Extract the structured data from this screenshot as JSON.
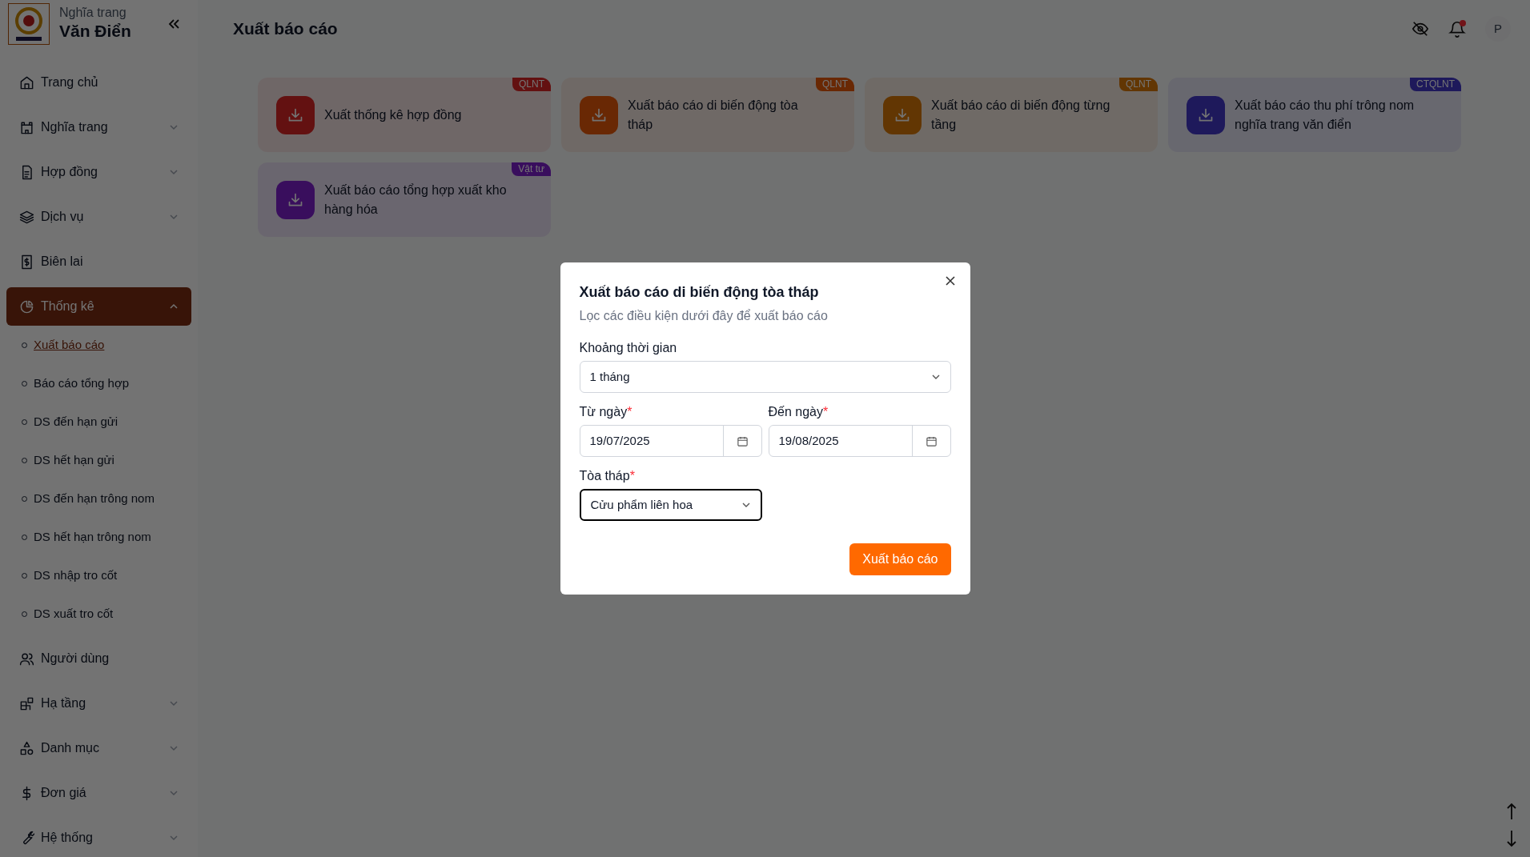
{
  "brand": {
    "subtitle": "Nghĩa trang",
    "title": "Văn Điển"
  },
  "sidebar": {
    "items": [
      {
        "label": "Trang chủ",
        "selected": false
      },
      {
        "label": "Nghĩa trang",
        "selected": false,
        "expanded": false
      },
      {
        "label": "Hợp đồng",
        "selected": false,
        "expanded": false
      },
      {
        "label": "Dịch vụ",
        "selected": false,
        "expanded": false
      },
      {
        "label": "Biên lai",
        "selected": false
      },
      {
        "label": "Thống kê",
        "selected": true,
        "expanded": true,
        "children": [
          {
            "label": "Xuất báo cáo",
            "selected": true
          },
          {
            "label": "Báo cáo tổng hợp",
            "selected": false
          },
          {
            "label": "DS đến hạn gửi",
            "selected": false
          },
          {
            "label": "DS hết hạn gửi",
            "selected": false
          },
          {
            "label": "DS đến hạn trông nom",
            "selected": false
          },
          {
            "label": "DS hết hạn trông nom",
            "selected": false
          },
          {
            "label": "DS nhập tro cốt",
            "selected": false
          },
          {
            "label": "DS xuất tro cốt",
            "selected": false
          }
        ]
      },
      {
        "label": "Người dùng",
        "selected": false
      },
      {
        "label": "Hạ tầng",
        "selected": false,
        "expanded": false
      },
      {
        "label": "Danh mục",
        "selected": false,
        "expanded": false
      },
      {
        "label": "Đơn giá",
        "selected": false,
        "expanded": false
      },
      {
        "label": "Hệ thống",
        "selected": false,
        "expanded": false
      }
    ]
  },
  "page_title": "Xuất báo cáo",
  "header": {
    "avatar": "P",
    "notification": true
  },
  "report_cards": [
    {
      "title": "Xuất thống kê hợp đồng",
      "badge": "QLNT",
      "color": "#631111"
    },
    {
      "title": "Xuất báo cáo di biến động tòa tháp",
      "badge": "QLNT",
      "color": "#692805"
    },
    {
      "title": "Xuất báo cáo di biến động từng tầng",
      "badge": "QLNT",
      "color": "#623603"
    },
    {
      "title": "Xuất báo cáo thu phí trông nom nghĩa trang văn điển",
      "badge": "CTQLNT",
      "color": "#1e195b"
    },
    {
      "title": "Xuất báo cáo tổng hợp xuất kho hàng hóa",
      "badge": "Vật tư",
      "color": "#390f5d"
    }
  ],
  "dialog": {
    "title": "Xuất báo cáo di biến động tòa tháp",
    "subtitle": "Lọc các điều kiện dưới đây để xuất báo cáo",
    "required_mark": "*",
    "fields": [
      {
        "kind": "select",
        "label": "Khoảng thời gian",
        "required": false,
        "value": "1 tháng",
        "focused": false
      },
      {
        "kind": "date",
        "label": "Từ ngày",
        "required": true,
        "value": "19/07/2025",
        "focused": false
      },
      {
        "kind": "date",
        "label": "Đến ngày",
        "required": true,
        "value": "19/08/2025",
        "focused": false
      },
      {
        "kind": "select",
        "label": "Tòa tháp",
        "required": true,
        "value": "Cửu phẩm liên hoa",
        "focused": true
      }
    ],
    "submit": "Xuất báo cáo"
  }
}
